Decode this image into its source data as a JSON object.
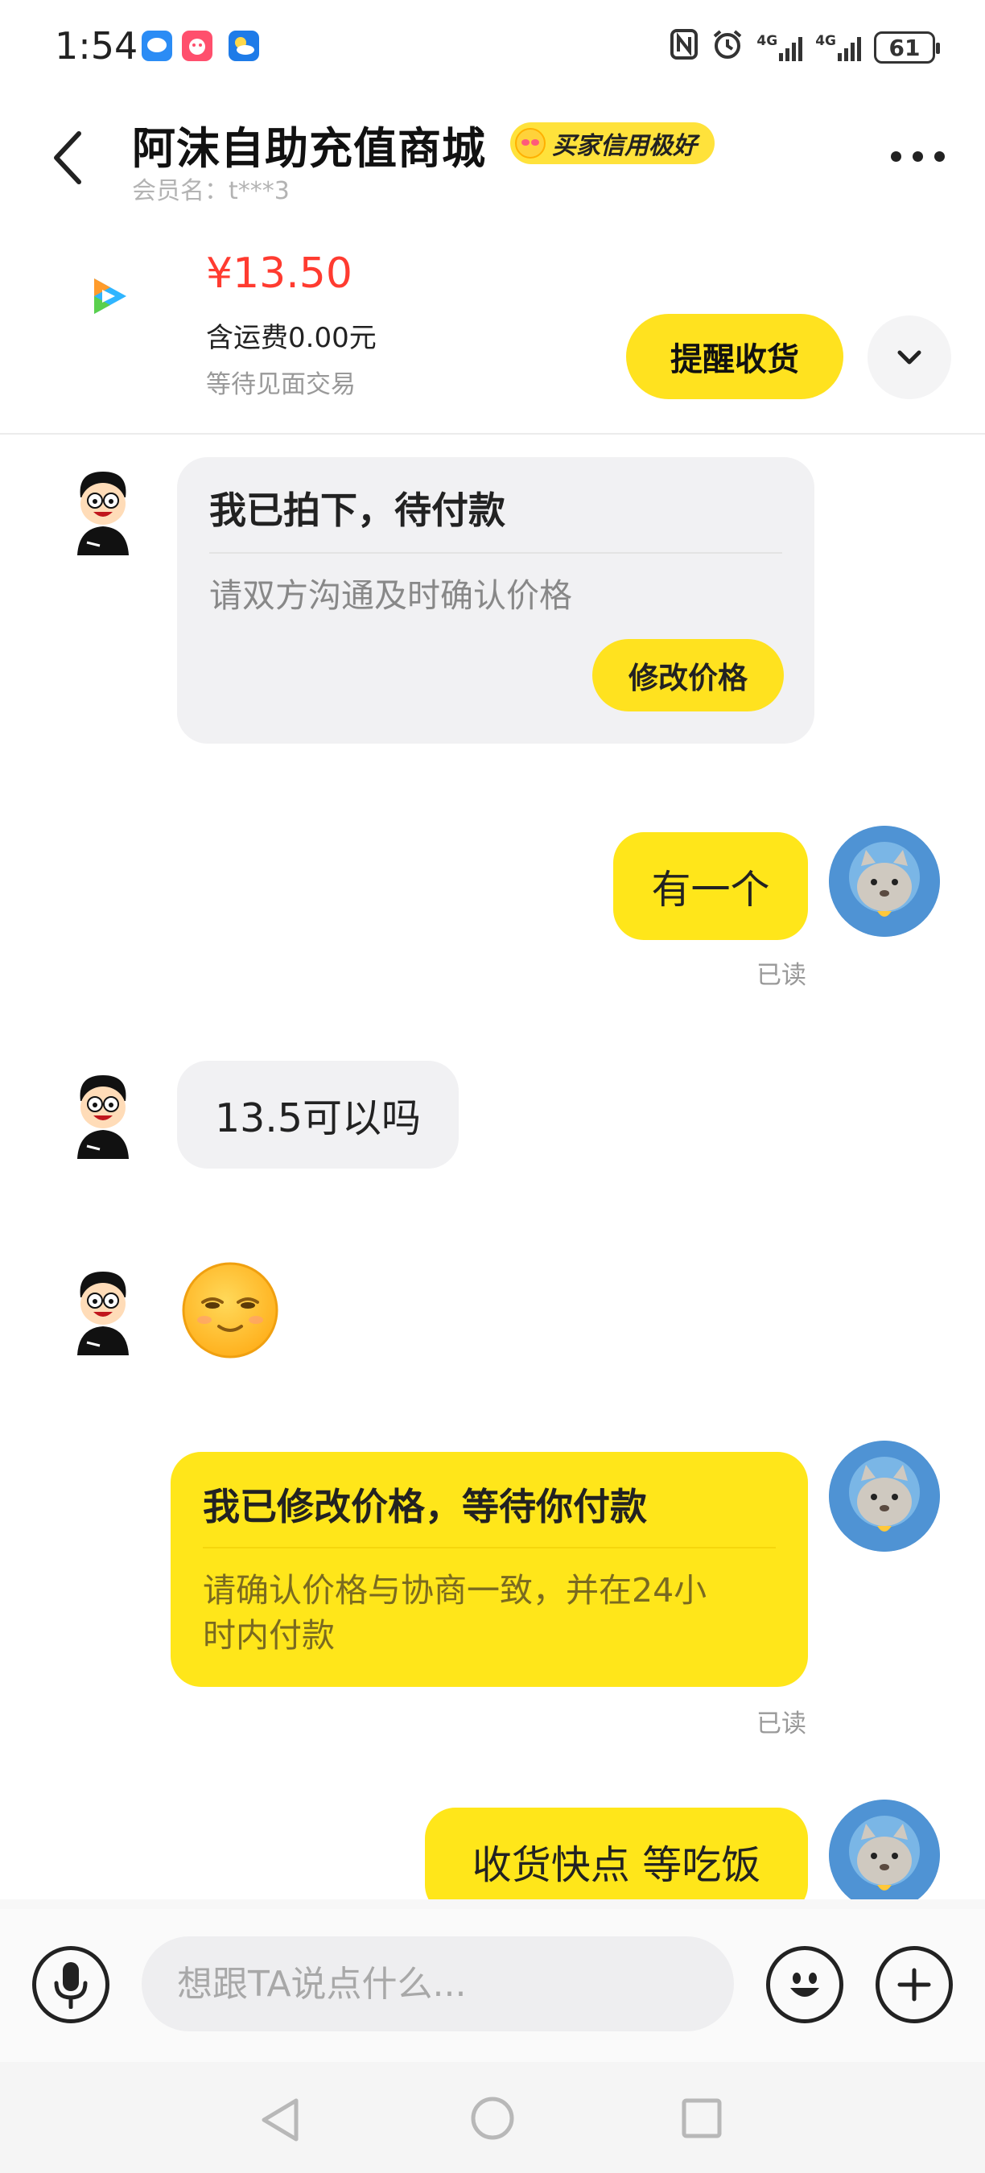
{
  "status_bar": {
    "time": "1:54",
    "network_1": "4G",
    "network_2": "4G",
    "battery": "61"
  },
  "header": {
    "shop_name": "阿沫自助充值商城",
    "credit_badge": "买家信用极好",
    "member_label": "会员名：t***3",
    "back_icon": "back-arrow-icon",
    "more_icon": "more-dots-icon"
  },
  "order": {
    "price": "¥13.50",
    "shipping": "含运费0.00元",
    "status": "等待见面交易",
    "remind_button": "提醒收货"
  },
  "messages": [
    {
      "side": "left",
      "type": "card",
      "title": "我已拍下，待付款",
      "desc": "请双方沟通及时确认价格",
      "button": "修改价格"
    },
    {
      "side": "right",
      "type": "text",
      "text": "有一个",
      "read": "已读"
    },
    {
      "side": "left",
      "type": "text",
      "text": "13.5可以吗"
    },
    {
      "side": "left",
      "type": "emoji",
      "emoji": "smug-face-emoji"
    },
    {
      "side": "right",
      "type": "card",
      "title": "我已修改价格，等待你付款",
      "desc_line1": "请确认价格与协商一致，并在24小",
      "desc_line2": "时内付款",
      "read": "已读"
    },
    {
      "side": "right",
      "type": "text",
      "text": "收货快点 等吃饭"
    }
  ],
  "input": {
    "placeholder": "想跟TA说点什么..."
  },
  "colors": {
    "accent_yellow": "#ffe21f",
    "price_red": "#ff3b30",
    "bubble_gray": "#f1f1f3"
  }
}
